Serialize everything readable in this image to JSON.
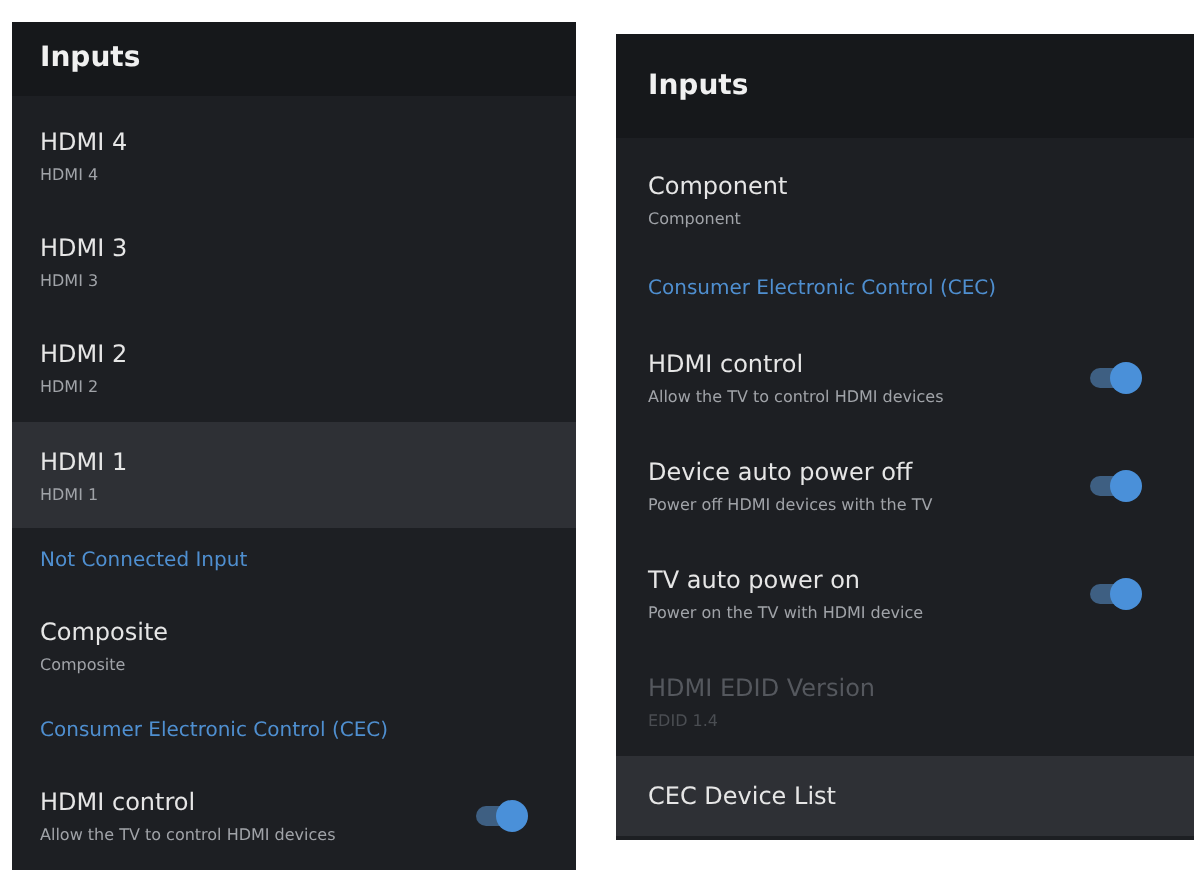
{
  "panels": [
    {
      "title": "Inputs",
      "items": [
        {
          "kind": "item",
          "title": "HDMI 4",
          "subtitle": "HDMI 4",
          "selected": false
        },
        {
          "kind": "item",
          "title": "HDMI 3",
          "subtitle": "HDMI 3",
          "selected": false
        },
        {
          "kind": "item",
          "title": "HDMI 2",
          "subtitle": "HDMI 2",
          "selected": false
        },
        {
          "kind": "item",
          "title": "HDMI 1",
          "subtitle": "HDMI 1",
          "selected": true
        },
        {
          "kind": "header",
          "title": "Not Connected Input"
        },
        {
          "kind": "item",
          "title": "Composite",
          "subtitle": "Composite",
          "selected": false
        },
        {
          "kind": "header",
          "title": "Consumer Electronic Control (CEC)"
        },
        {
          "kind": "toggle",
          "title": "HDMI control",
          "subtitle": "Allow the TV to control HDMI devices",
          "on": true,
          "selected": false
        }
      ]
    },
    {
      "title": "Inputs",
      "items": [
        {
          "kind": "item",
          "title": "Component",
          "subtitle": "Component",
          "selected": false
        },
        {
          "kind": "header",
          "title": "Consumer Electronic Control (CEC)"
        },
        {
          "kind": "toggle",
          "title": "HDMI control",
          "subtitle": "Allow the TV to control HDMI devices",
          "on": true,
          "selected": false
        },
        {
          "kind": "toggle",
          "title": "Device auto power off",
          "subtitle": "Power off HDMI devices with the TV",
          "on": true,
          "selected": false
        },
        {
          "kind": "toggle",
          "title": "TV auto power on",
          "subtitle": "Power on the TV with HDMI device",
          "on": true,
          "selected": false
        },
        {
          "kind": "item",
          "title": "HDMI EDID Version",
          "subtitle": "EDID 1.4",
          "selected": false,
          "disabled": true
        },
        {
          "kind": "item",
          "title": "CEC Device List",
          "selected": true
        }
      ]
    }
  ]
}
